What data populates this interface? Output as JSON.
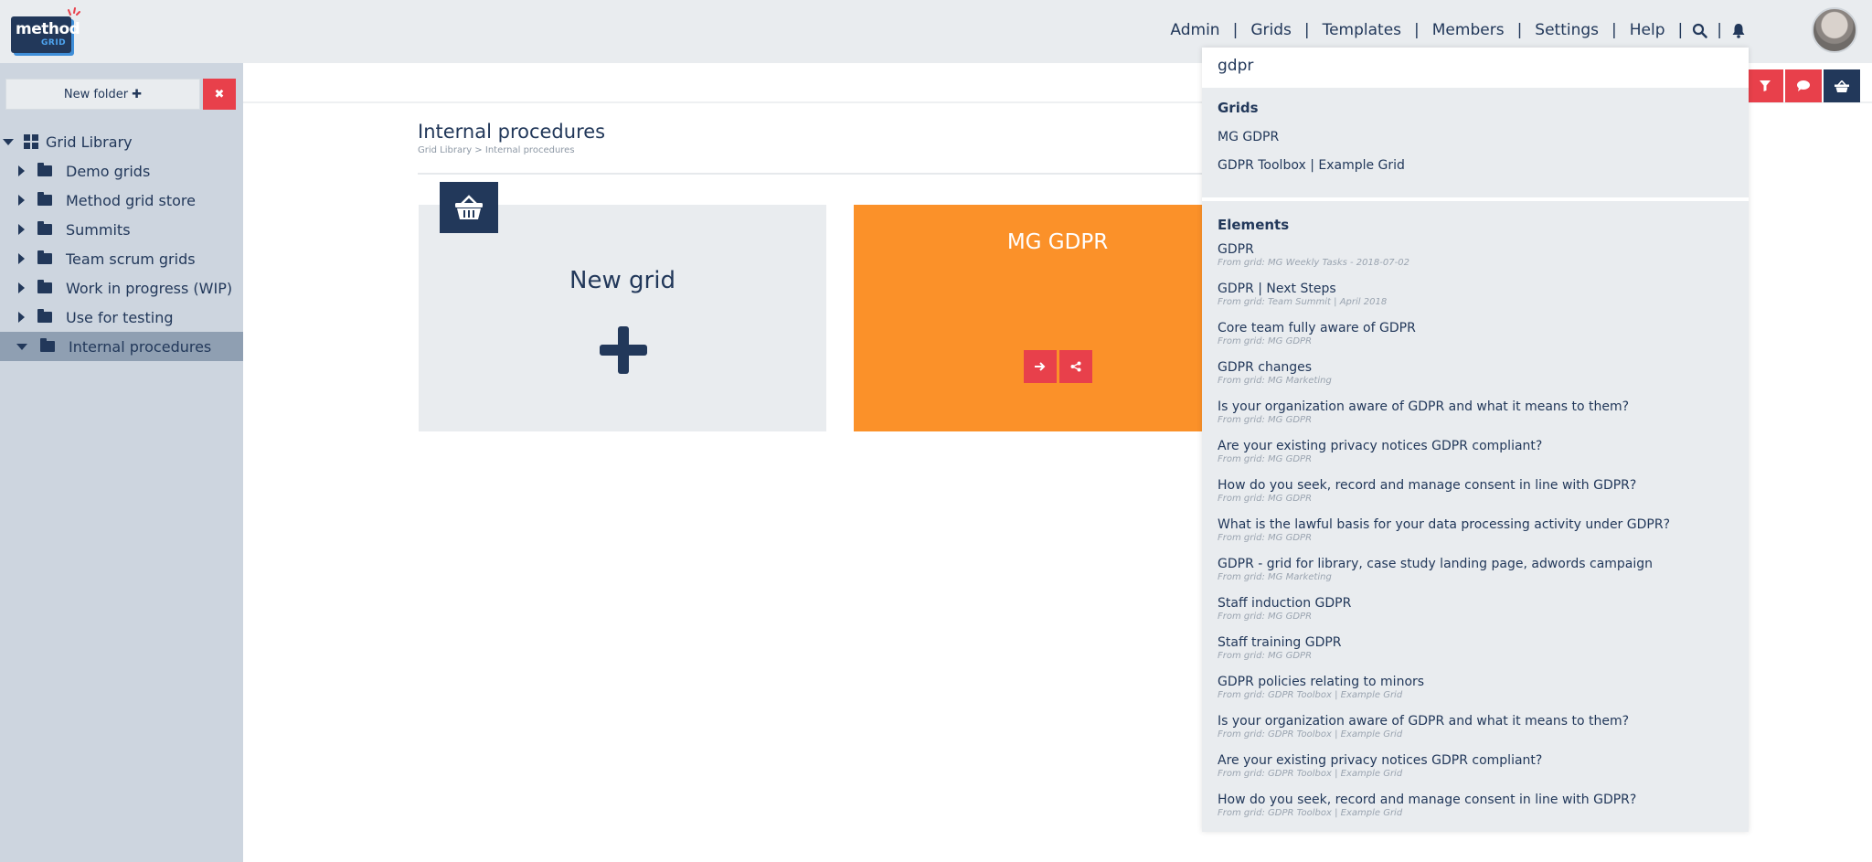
{
  "logo": {
    "line1": "method",
    "line2": "GRID"
  },
  "nav": {
    "items": [
      "Admin",
      "Grids",
      "Templates",
      "Members",
      "Settings",
      "Help"
    ],
    "separator": "|"
  },
  "sidebar": {
    "new_folder_label": "New folder ✚",
    "close_label": "✖",
    "root_label": "Grid Library",
    "folders": [
      "Demo grids",
      "Method grid store",
      "Summits",
      "Team scrum grids",
      "Work in progress (WIP)",
      "Use for testing",
      "Internal procedures"
    ],
    "selected": "Internal procedures"
  },
  "main": {
    "title": "Internal procedures",
    "breadcrumb": "Grid Library > Internal procedures",
    "new_grid_label": "New grid",
    "grid_card_title": "MG GDPR"
  },
  "colors": {
    "navy": "#22385a",
    "accent_red": "#e8404b",
    "card_orange": "#fb9129",
    "sidebar_bg": "#cdd5df"
  },
  "search": {
    "query": "gdpr",
    "grids_heading": "Grids",
    "grids": [
      "MG GDPR",
      "GDPR Toolbox | Example Grid"
    ],
    "elements_heading": "Elements",
    "elements": [
      {
        "title": "GDPR",
        "from": "From grid: MG Weekly Tasks - 2018-07-02"
      },
      {
        "title": "GDPR | Next Steps",
        "from": "From grid: Team Summit | April 2018"
      },
      {
        "title": "Core team fully aware of GDPR",
        "from": "From grid: MG GDPR"
      },
      {
        "title": "GDPR changes",
        "from": "From grid: MG Marketing"
      },
      {
        "title": "Is your organization aware of GDPR and what it means to them?",
        "from": "From grid: MG GDPR"
      },
      {
        "title": "Are your existing privacy notices GDPR compliant?",
        "from": "From grid: MG GDPR"
      },
      {
        "title": "How do you seek, record and manage consent in line with GDPR?",
        "from": "From grid: MG GDPR"
      },
      {
        "title": "What is the lawful basis for your data processing activity under GDPR?",
        "from": "From grid: MG GDPR"
      },
      {
        "title": "GDPR - grid for library, case study landing page, adwords campaign",
        "from": "From grid: MG Marketing"
      },
      {
        "title": "Staff induction GDPR",
        "from": "From grid: MG GDPR"
      },
      {
        "title": "Staff training GDPR",
        "from": "From grid: MG GDPR"
      },
      {
        "title": "GDPR policies relating to minors",
        "from": "From grid: GDPR Toolbox | Example Grid"
      },
      {
        "title": "Is your organization aware of GDPR and what it means to them?",
        "from": "From grid: GDPR Toolbox | Example Grid"
      },
      {
        "title": "Are your existing privacy notices GDPR compliant?",
        "from": "From grid: GDPR Toolbox | Example Grid"
      },
      {
        "title": "How do you seek, record and manage consent in line with GDPR?",
        "from": "From grid: GDPR Toolbox | Example Grid"
      }
    ]
  }
}
